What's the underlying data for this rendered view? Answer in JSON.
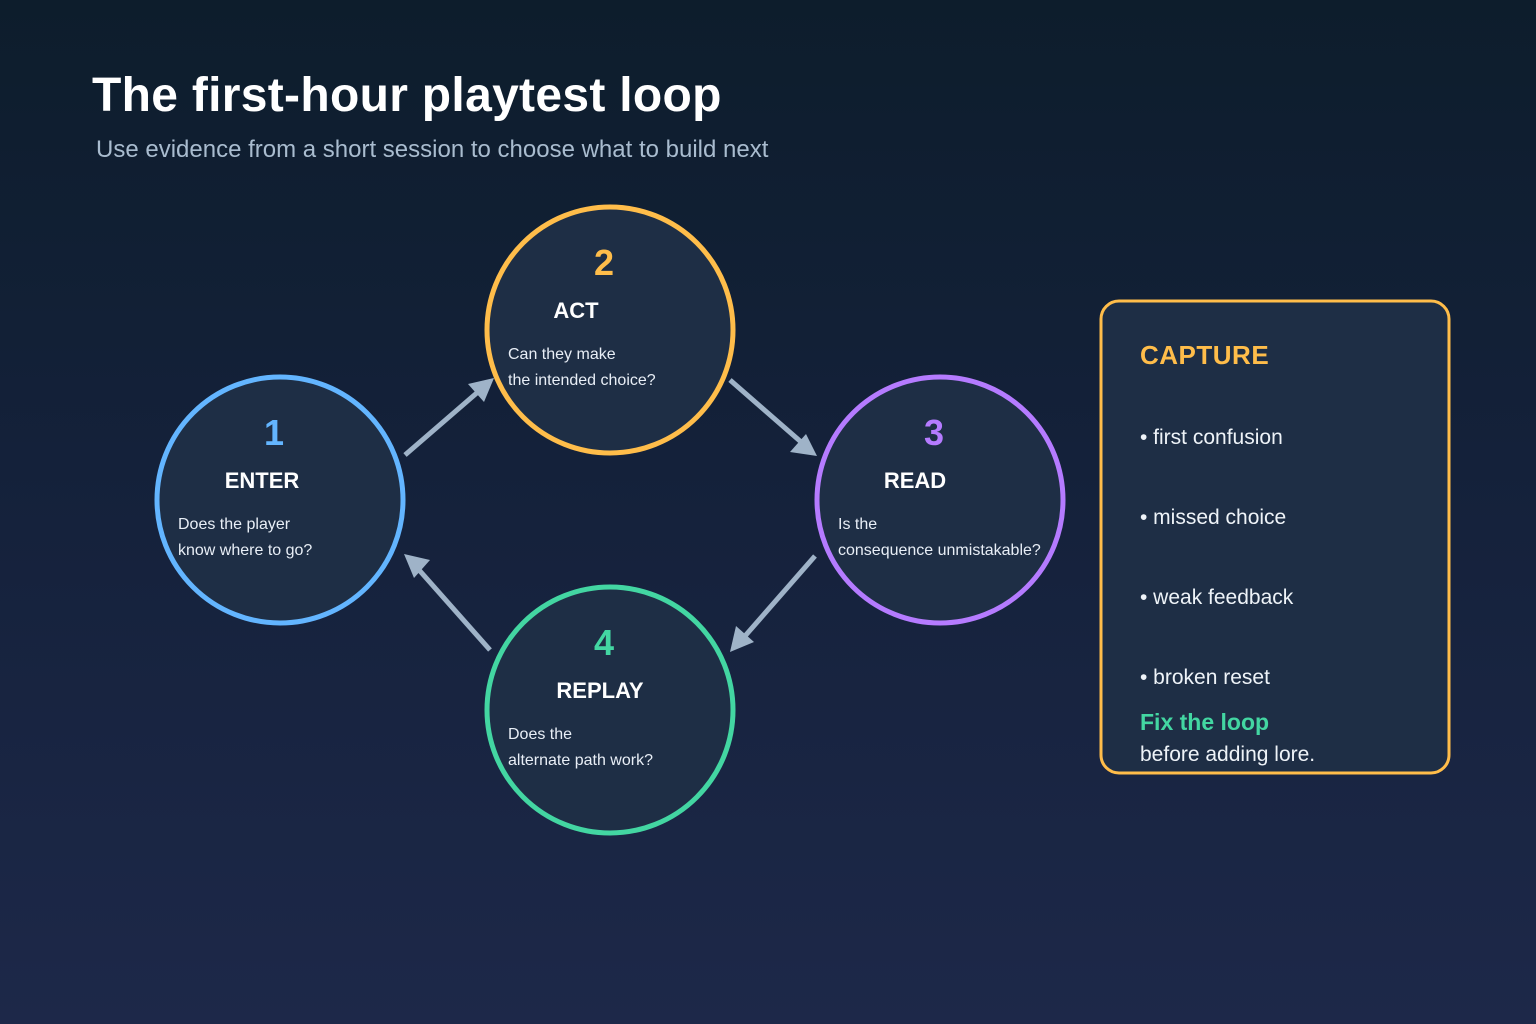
{
  "header": {
    "title": "The first-hour playtest loop",
    "subtitle": "Use evidence from a short session to choose what to build next"
  },
  "colors": {
    "node_fill": "#1e2e45",
    "arrow": "#9fb3c8",
    "enter": "#63b5ff",
    "act": "#ffbd4a",
    "read": "#b57bff",
    "replay": "#43d6a2",
    "card_border": "#ffbd4a",
    "card_title": "#ffbd4a",
    "card_foot_strong": "#43d6a2"
  },
  "nodes": [
    {
      "number": "1",
      "label": "ENTER",
      "line1": "Does the player",
      "line2": "know where to go?"
    },
    {
      "number": "2",
      "label": "ACT",
      "line1": "Can they make",
      "line2": "the intended choice?"
    },
    {
      "number": "3",
      "label": "READ",
      "line1": "Is the",
      "line2": "consequence unmistakable?"
    },
    {
      "number": "4",
      "label": "REPLAY",
      "line1": "Does the",
      "line2": "alternate path work?"
    }
  ],
  "capture": {
    "title": "CAPTURE",
    "items": [
      "• first confusion",
      "• missed choice",
      "• weak feedback",
      "• broken reset"
    ],
    "footer_strong": "Fix the loop",
    "footer_text": "before adding lore."
  }
}
